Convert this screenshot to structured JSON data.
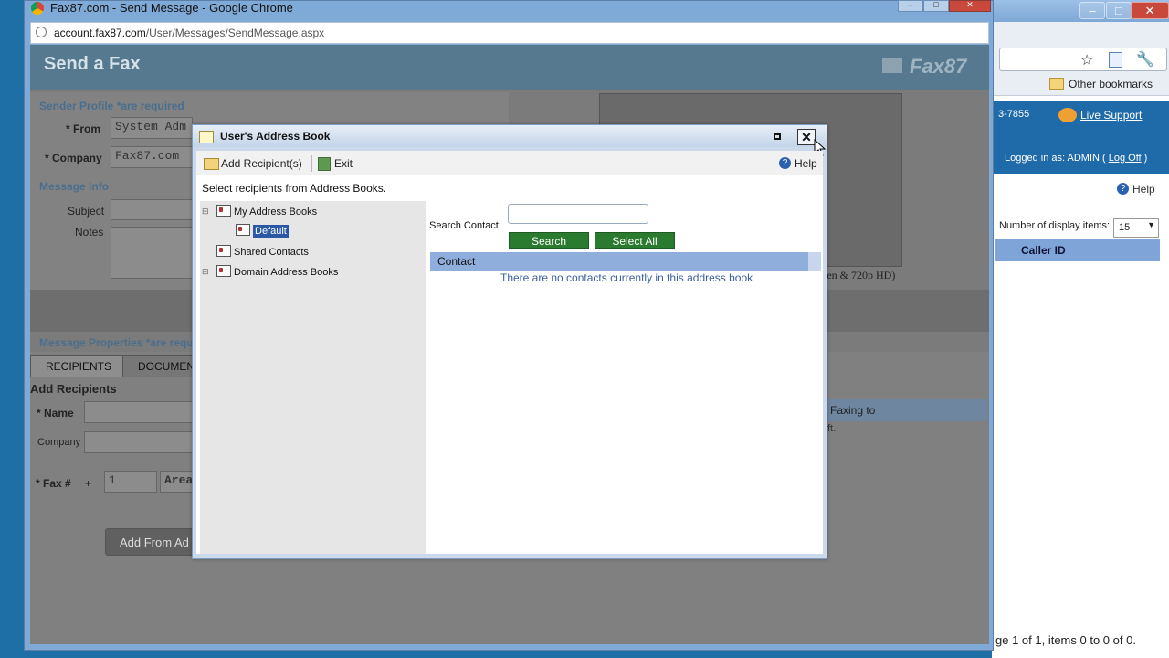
{
  "browser": {
    "window_title": "Fax87.com - Send Message - Google Chrome",
    "url_host": "account.fax87.com",
    "url_path": "/User/Messages/SendMessage.aspx"
  },
  "background_window": {
    "other_bookmarks": "Other bookmarks",
    "phone_fragment": "3-7855",
    "live_support": "Live Support",
    "logged_in_prefix": "Logged in as: ADMIN ( ",
    "log_off": "Log Off",
    "logged_in_suffix": " )",
    "help": "Help",
    "display_items_label": "Number of display items:",
    "display_items_value": "15",
    "caller_id_header": "Caller ID",
    "pager_text": "ge 1 of 1, items 0 to 0 of 0."
  },
  "page": {
    "title": "Send a Fax",
    "logo": "Fax87",
    "sender_profile_label": "Sender Profile *are required",
    "from_label": "* From",
    "from_value": "System Adm",
    "company_label": "* Company",
    "company_value": "Fax87.com",
    "message_info_label": "Message Info",
    "subject_label": "Subject",
    "notes_label": "Notes",
    "message_properties_label": "Message Properties *are requ",
    "tabs": [
      "RECIPIENTS",
      "DOCUMEN"
    ],
    "add_recipients_heading": "Add Recipients",
    "name_label": "* Name",
    "recipient_company_label": "Company",
    "fax_label": "* Fax #",
    "fax_plus": "+",
    "fax_country_value": "1",
    "fax_area_value": "Area",
    "add_from_button": "Add From Ad",
    "video_caption": "een & 720p HD)",
    "faxing_to": "Faxing to",
    "ft_fragment": "ft."
  },
  "dialog": {
    "title": "User's Address Book",
    "toolbar": {
      "add_recipients": "Add Recipient(s)",
      "exit": "Exit",
      "help": "Help"
    },
    "instructions": "Select recipients from Address Books.",
    "tree": {
      "my_address_books": "My Address Books",
      "default": "Default",
      "shared_contacts": "Shared Contacts",
      "domain_address_books": "Domain Address Books"
    },
    "search_label": "Search Contact:",
    "search_value": "",
    "search_button": "Search",
    "select_all_button": "Select All",
    "contact_column": "Contact",
    "empty_message": "There are no contacts currently in this address book"
  }
}
